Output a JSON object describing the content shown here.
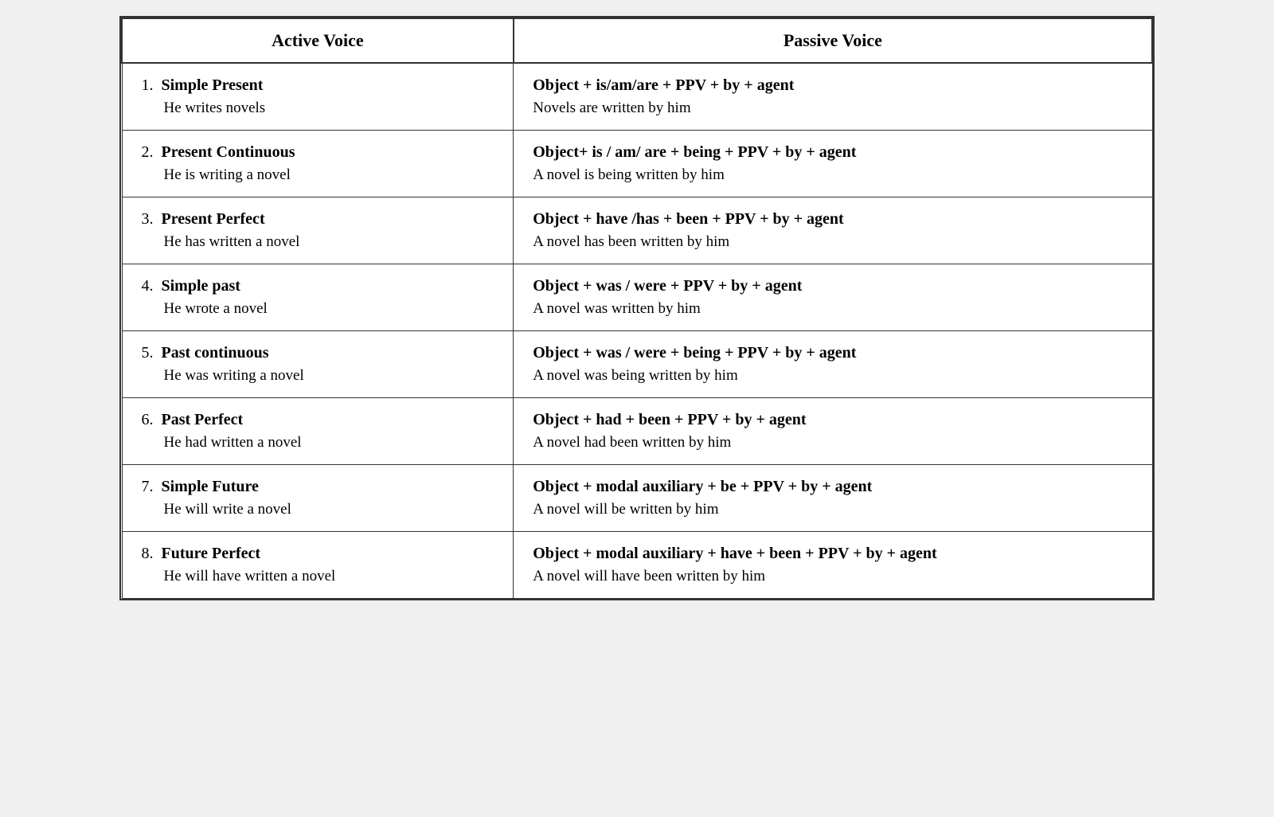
{
  "headers": {
    "active": "Active Voice",
    "passive": "Passive Voice"
  },
  "rows": [
    {
      "number": "1.",
      "tense": "Simple Present",
      "active_example": "He writes novels",
      "passive_formula": "Object + is/am/are + PPV + by + agent",
      "passive_example": "Novels are written by him"
    },
    {
      "number": "2.",
      "tense": "Present Continuous",
      "active_example": "He is writing a novel",
      "passive_formula": "Object+ is / am/ are + being + PPV + by + agent",
      "passive_example": "A novel is being written by him"
    },
    {
      "number": "3.",
      "tense": "Present Perfect",
      "active_example": "He has written a novel",
      "passive_formula": "Object + have /has + been + PPV + by + agent",
      "passive_example": "A novel has been written by him"
    },
    {
      "number": "4.",
      "tense": "Simple past",
      "active_example": "He wrote a novel",
      "passive_formula": "Object + was / were + PPV + by + agent",
      "passive_example": "A novel was written by him"
    },
    {
      "number": "5.",
      "tense": "Past continuous",
      "active_example": "He was writing a novel",
      "passive_formula": "Object + was / were + being + PPV + by + agent",
      "passive_example": "A novel was  being written by him"
    },
    {
      "number": "6.",
      "tense": "Past Perfect",
      "active_example": "He had written a novel",
      "passive_formula": "Object + had + been + PPV + by + agent",
      "passive_example": "A novel had been written by him"
    },
    {
      "number": "7.",
      "tense": "Simple Future",
      "active_example": "He will write a novel",
      "passive_formula": "Object + modal auxiliary + be + PPV + by + agent",
      "passive_example": "A novel will be written by him"
    },
    {
      "number": "8.",
      "tense": "Future Perfect",
      "active_example": "He will have written a novel",
      "passive_formula": "Object + modal auxiliary +  have + been + PPV + by + agent",
      "passive_example": "A novel will have been written by him"
    }
  ]
}
